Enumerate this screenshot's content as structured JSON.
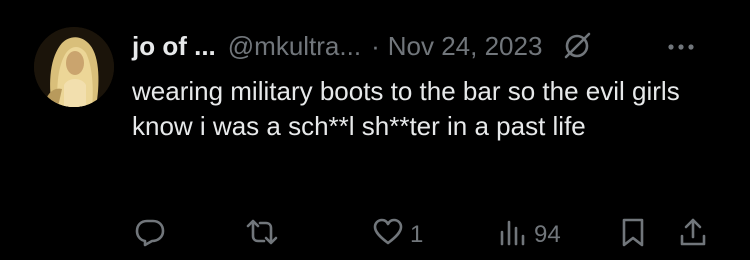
{
  "author": {
    "display_name": "jo of ...",
    "handle": "@mkultra...",
    "separator": "·",
    "date": "Nov 24, 2023"
  },
  "tweet": {
    "text": "wearing military boots to the bar so the evil girls know i was a sch**l sh**ter in a past life"
  },
  "actions": {
    "reply_icon": "reply-icon",
    "repost_icon": "repost-icon",
    "like_icon": "heart-icon",
    "like_count": "1",
    "views_icon": "views-chart-icon",
    "views_count": "94",
    "bookmark_icon": "bookmark-icon",
    "share_icon": "share-icon"
  },
  "colors": {
    "background": "#000000",
    "primary_text": "#e7e9ea",
    "secondary_text": "#71767b"
  }
}
